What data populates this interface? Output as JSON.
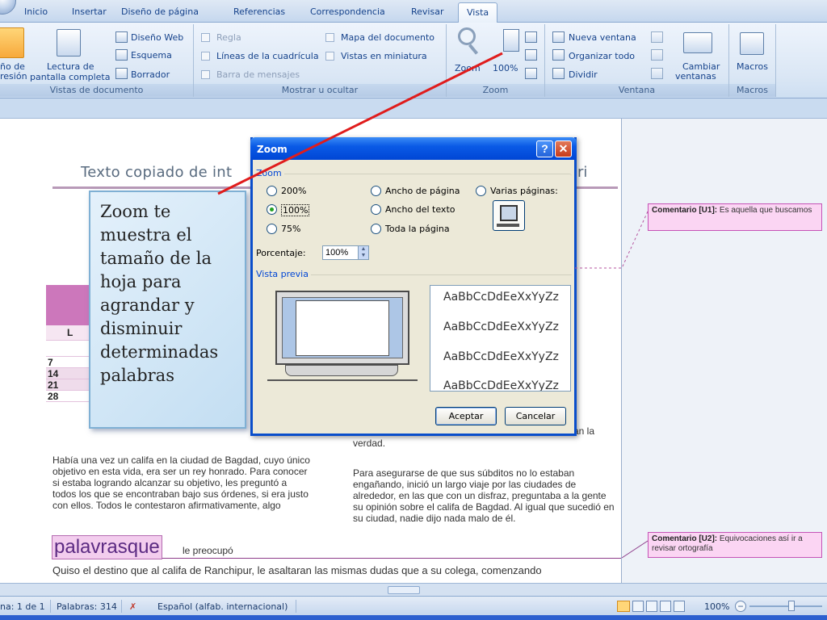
{
  "tabs": [
    "Inicio",
    "Insertar",
    "Diseño de página",
    "Referencias",
    "Correspondencia",
    "Revisar",
    "Vista"
  ],
  "ribbon": {
    "vistas": {
      "print_layout_line1": "ño de",
      "print_layout_line2": "resión",
      "reading_line1": "Lectura de",
      "reading_line2": "pantalla completa",
      "web": "Diseño Web",
      "outline": "Esquema",
      "draft": "Borrador",
      "group": "Vistas de documento"
    },
    "mostrar": {
      "ruler": "Regla",
      "gridlines": "Líneas de la cuadrícula",
      "message_bar": "Barra de mensajes",
      "doc_map": "Mapa del documento",
      "thumbnails": "Vistas en miniatura",
      "group": "Mostrar u ocultar"
    },
    "zoom": {
      "zoom": "Zoom",
      "pct": "100%",
      "group": "Zoom"
    },
    "ventana": {
      "new_window": "Nueva ventana",
      "arrange_all": "Organizar todo",
      "split": "Dividir",
      "switch_line1": "Cambiar",
      "switch_line2": "ventanas",
      "group": "Ventana"
    },
    "macros": {
      "label": "Macros",
      "group": "Macros"
    }
  },
  "document": {
    "title": "Texto copiado de int",
    "title_tail": "ri",
    "calendar": {
      "day_header": "L",
      "days": [
        "7",
        "14",
        "21",
        "28"
      ]
    },
    "col1": "Había una vez un califa en la ciudad de Bagdad, cuyo único objetivo en esta vida, era ser un rey honrado. Para conocer si estaba logrando alcanzar su objetivo, les preguntó a todos los que se encontraban bajo sus órdenes, si era justo con ellos. Todos le contestaron afirmativamente, algo",
    "col2_top_right": "an la",
    "col2_top": "verdad.",
    "col2": "Para asegurarse de que sus súbditos no lo estaban engañando, inició un largo viaje por las ciudades de alrededor, en las que con un disfraz, preguntaba a la gente su opinión sobre el califa de Bagdad. Al igual que sucedió en su ciudad, nadie dijo nada malo de él.",
    "typo_word": "palavrasque",
    "typo_rest": "le preocupó",
    "bottom_line": "Quiso el destino que al califa de Ranchipur, le asaltaran las mismas dudas que a su colega, comenzando"
  },
  "comments": {
    "c1_label": "Comentario [U1]:",
    "c1_text": "Es aquella que buscamos",
    "c2_label": "Comentario [U2]:",
    "c2_text": "Equivocaciones así ir a revisar ortografía"
  },
  "callout": {
    "text": "Zoom te muestra el tamaño de la hoja para agrandar y disminuir determinadas palabras"
  },
  "dialog": {
    "title": "Zoom",
    "help": "?",
    "close": "✕",
    "zoom_section": "Zoom",
    "options": {
      "p200": "200%",
      "p100": "100%",
      "p75": "75%",
      "page_width": "Ancho de página",
      "text_width": "Ancho del texto",
      "whole_page": "Toda la página",
      "many_pages": "Varias páginas:"
    },
    "percent_label": "Porcentaje:",
    "percent_value": "100%",
    "preview_section": "Vista previa",
    "sample": "AaBbCcDdEeXxYyZz",
    "ok": "Aceptar",
    "cancel": "Cancelar"
  },
  "statusbar": {
    "page": "na: 1 de 1",
    "words": "Palabras: 314",
    "language": "Español (alfab. internacional)",
    "zoom": "100%"
  },
  "colors": {
    "accent_blue": "#15428b",
    "dialog_title": "#0046d5",
    "comment_bg": "#fbd5f3",
    "arrow": "#e01c1c"
  }
}
